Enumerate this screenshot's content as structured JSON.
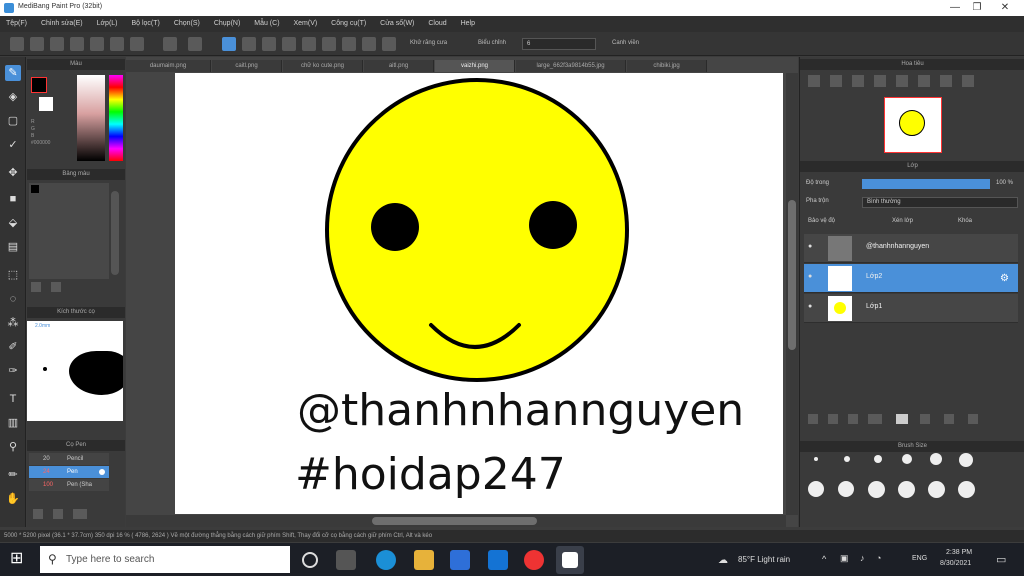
{
  "window": {
    "title": "MediBang Paint Pro (32bit)",
    "minimize": "—",
    "maximize": "❐",
    "close": "✕"
  },
  "menu": [
    "Tệp(F)",
    "Chỉnh sửa(E)",
    "Lớp(L)",
    "Bộ lọc(T)",
    "Chọn(S)",
    "Chụp(N)",
    "Mẫu (C)",
    "Xem(V)",
    "Công cụ(T)",
    "Cửa sổ(W)",
    "Cloud",
    "Help"
  ],
  "toolbar": {
    "snap_label": "Khử răng cưa",
    "correction_label": "Biểu chỉnh",
    "correction_value": "6",
    "autoscroll_label": "Canh viền"
  },
  "tabs": [
    "daumaim.png",
    "caitl.png",
    "chữ ko cute.png",
    "aitl.png",
    "vaizhi.png",
    "large_662f3a9814b55.jpg",
    "chibiki.jpg"
  ],
  "left": {
    "color_panel": "Màu",
    "palette_panel": "Bảng màu",
    "brush_size_panel": "Kích thước cọ",
    "brush_size_value": "2.0mm",
    "brush_panel": "Cọ Pen",
    "brushes": [
      {
        "size": "20",
        "name": "Pencil"
      },
      {
        "size": "24",
        "name": "Pen"
      },
      {
        "size": "100",
        "name": "Pen (Sha"
      }
    ]
  },
  "canvas": {
    "text1": "@thanhnhannguyen",
    "text2": "#hoidap247"
  },
  "right": {
    "navigator_panel": "Hoa tiêu",
    "layer_panel": "Lớp",
    "opacity_label": "Độ trong",
    "opacity_value": "100 %",
    "blend_label": "Pha trộn",
    "blend_value": "Bình thường",
    "protect_alpha": "Bảo vệ độ",
    "clipping": "Xén lớp",
    "lock": "Khóa",
    "layers": [
      {
        "name": "@thanhnhannguyen"
      },
      {
        "name": "Lớp2"
      },
      {
        "name": "Lớp1"
      }
    ],
    "brush_size_panel": "Brush Size"
  },
  "status": {
    "text": "5000 * 5200 pixel   (36.1 * 37.7cm)   350 dpi   16 %   ( 4786, 2624 )   Vẽ một đường thẳng bằng cách giữ phím Shift, Thay đổi cỡ cọ bằng cách giữ phím Ctrl, Alt và kéo"
  },
  "taskbar": {
    "search_placeholder": "Type here to search",
    "weather": "85°F  Light rain",
    "lang": "ENG",
    "time": "2:38 PM",
    "date": "8/30/2021"
  },
  "colors": {
    "accent": "#4a90d9",
    "face": "#ffff00",
    "primary_color": "#000000",
    "secondary_color": "#ffffff"
  }
}
